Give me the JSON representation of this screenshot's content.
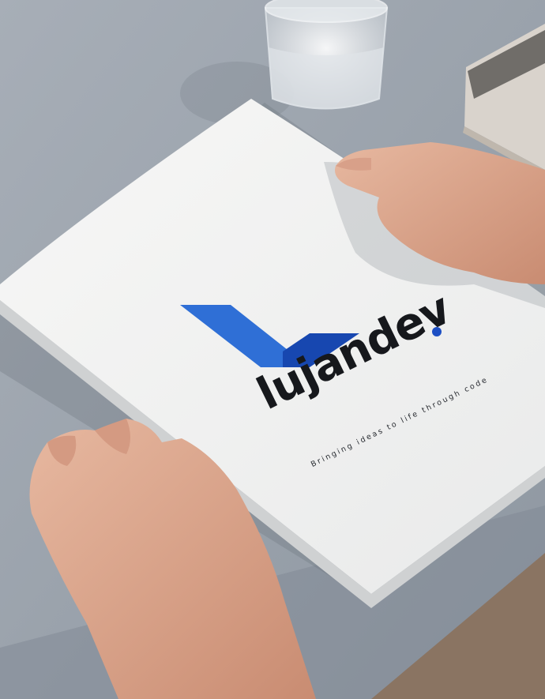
{
  "photo": {
    "description_items": [
      "table",
      "glass-of-water",
      "stack-of-prints",
      "left-hand",
      "right-hand",
      "brochure"
    ]
  },
  "brochure": {
    "brand_name": "lujandev",
    "brand_dot": ".",
    "tagline": "Bringing ideas to life through code",
    "colors": {
      "logo_blue_light": "#2f6fd6",
      "logo_blue_dark": "#1747b0",
      "wordmark": "#16181c",
      "dot": "#1d4fc4",
      "paper": "#f4f4f2",
      "table": "#9aa3ad"
    }
  }
}
